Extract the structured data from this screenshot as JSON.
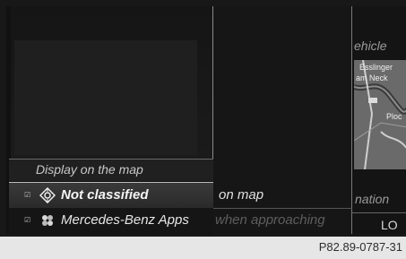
{
  "right_panel": {
    "title_fragment": "ehicle",
    "map": {
      "place1": "Esslinger",
      "place2": "am Neck",
      "place3": "Ploc"
    },
    "label_fragment": "nation",
    "value": "LO"
  },
  "menu": {
    "header": "Display on the map",
    "items": [
      {
        "label": "Not classified",
        "checkbox": "☑",
        "icon": "poi-diamond-icon"
      },
      {
        "label": "Mercedes-Benz Apps",
        "checkbox": "☑",
        "icon": "apps-icon"
      }
    ]
  },
  "background_text": {
    "line1": "on map",
    "line2": "when approaching"
  },
  "caption": "P82.89-0787-31"
}
